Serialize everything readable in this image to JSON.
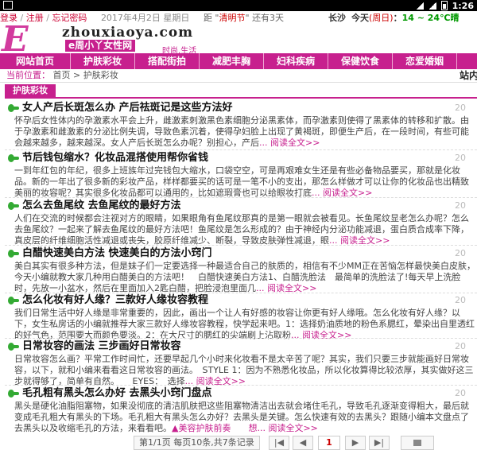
{
  "statusbar": {
    "time": "1:26"
  },
  "topbar": {
    "login": "登录",
    "register": "注册",
    "forgot": "忘记密码",
    "date": "2017年4月2日 星期日",
    "festival_prefix": "距",
    "festival_name": "清明节",
    "festival_suffix": "还有3天",
    "city": "长沙",
    "today": "今天",
    "weekday": "(周日)",
    "temp": "14 ~ 24℃",
    "weather": "晴"
  },
  "logo": {
    "letter": "E",
    "domain": "zhouxiaoya.com",
    "cn_name": "e周小丫女性网",
    "tagline": "时尚.生活"
  },
  "nav": [
    "网站首页",
    "护肤彩妆",
    "搭配街拍",
    "减肥丰胸",
    "妇科疾病",
    "保健饮食",
    "恋爱婚姻"
  ],
  "breadcrumb": {
    "prefix": "当前位置：",
    "home": "首页",
    "current": "护肤彩妆",
    "station": "站内"
  },
  "section_title": "护肤彩妆",
  "articles": [
    {
      "title": "女人产后长斑怎么办 产后祛斑记是这些方法好",
      "date": "20",
      "body": "怀孕后女性体内的孕激素水平会上升，雌激素刺激黑色素细胞分泌黑素体，而孕激素则使得了黑素体的转移和扩散。由于孕激素和雌激素的分泌比例失调，导致色素沉着，使得孕妇脸上出现了黄褐斑，即便生产后，在一段时间，有些可能会越来越多，越来越深。女人产后长斑怎么办呢？别担心，产后",
      "more": "... 阅读全文>>"
    },
    {
      "title": "节后钱包缩水？化妆品混搭使用帮你省钱",
      "date": "20",
      "body": "一到年红包的年纪，很多上班族年过完钱包大缩水，口袋空空，可是再艰难女生还是有些必备物品要买，那就是化妆品。新的一年出了很多新的彩妆产品，样样都要买的话可是一笔不小的支出，那怎么样做才可以让你的化妆品也出精致美丽的妆容呢？其实很多化妆品都可以通用的，比如遮瑕膏也可以给眼妆打底",
      "more": "... 阅读全文>>"
    },
    {
      "title": "怎么去鱼尾纹 去鱼尾纹的最好方法",
      "date": "20",
      "body": "人们在交流的时候都会注视对方的眼睛，如果眼角有鱼尾纹那真的是第一眼就会被看见。长鱼尾纹显老怎么办呢？怎么去鱼尾纹？一起来了解去鱼尾纹的最好方法吧！鱼尾纹是怎么形成的？由于神经内分泌功能减退，蛋白质合成率下降，真皮层的纤维细胞活性减退或丧失，胶原纤维减少、断裂，导致皮肤弹性减退，眼",
      "more": "... 阅读全文>>"
    },
    {
      "title": "白醋快速美白方法 快速美白的方法小窍门",
      "date": "20",
      "body": "美白其实有很多种方法，但是妹子们一定要选择一种最适合自己的肤质的，相信有不少MM正在苦恼怎样最快美白皮肤，今天小编就教大家几种用白醋美白的方法吧！　白醋快速美白方法1、白醋洗脸法　最简单的洗脸法了!每天早上洗脸时，先放一小盆水，然后在里面加入2匙白醋，把脸浸泡里面几",
      "more": "... 阅读全文>>"
    },
    {
      "title": "怎么化妆有好人缘？三款好人缘妆容教程",
      "date": "20",
      "body": "我们日常生活中好人缘是非常重要的，因此，画出一个让人有好感的妆容让你更有好人缘哦。怎么化妆有好人缘？以下，女生私房话的小编就推荐大家三款好人缘妆容教程，快学起来吧。1：选择奶油质地的粉色系腮红，晕染出自里透红的好气色，范围要大而颜色要淡。2：在大尺寸的腮红的尖端刷上沾取粉",
      "more": "... 阅读全文>>"
    },
    {
      "title": "日常妆容的画法 三步画好日常妆容",
      "date": "20",
      "body": "日常妆容怎么画？平常工作时间忙，还要早起几个小时来化妆看不是太辛苦了呢？其实，我们只要三步就能画好日常妆容，以下，就和小编来看看这日常妆容的画法。　STYLE 1：因为不熟悉化妆品，所以化妆算得比较浓厚，其实做好这三步就得够了，简单有自然。　　EYES：　选择",
      "more": "... 阅读全文>>"
    },
    {
      "title": "毛孔粗有黑头怎么办好 去黑头小窍门盘点",
      "date": "20",
      "body": "黑头是硬化油脂阻塞物，如果没彻底的清洁肌肤把这些阻塞物清洁出去就会堵住毛孔，导致毛孔逐渐变得粗大，最后就变成毛孔粗大有黑头的下场。毛孔粗大有黑头怎么办好？去黑头是关键。怎么快速有效的去黑头？跟随小编本文盘点了去黑头以及收缩毛孔的方法，来看看吧。",
      "more": "▲美容护肤前奏　　想... 阅读全文>>"
    }
  ],
  "pager": {
    "info": "第1/1页 每页10条,共7条记录",
    "first": "|◀",
    "prev": "◀",
    "page": "1",
    "next": "▶",
    "last": "▶|"
  }
}
